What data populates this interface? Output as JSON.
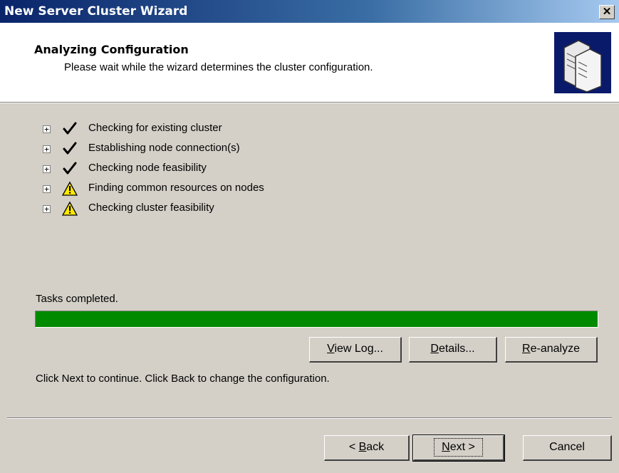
{
  "window": {
    "title": "New Server Cluster Wizard",
    "close_glyph": "✕"
  },
  "header": {
    "title": "Analyzing Configuration",
    "subtitle": "Please wait while the wizard determines the cluster configuration.",
    "icon": "server-cluster-icon"
  },
  "tasks": [
    {
      "label": "Checking for existing cluster",
      "status": "success",
      "expander": "+"
    },
    {
      "label": "Establishing node connection(s)",
      "status": "success",
      "expander": "+"
    },
    {
      "label": "Checking node feasibility",
      "status": "success",
      "expander": "+"
    },
    {
      "label": "Finding common resources on nodes",
      "status": "warning",
      "expander": "+"
    },
    {
      "label": "Checking cluster feasibility",
      "status": "warning",
      "expander": "+"
    }
  ],
  "progress": {
    "status_text": "Tasks completed.",
    "percent": 100,
    "color": "#008a00"
  },
  "actions": {
    "view_log": {
      "hotkey": "V",
      "rest": "iew Log..."
    },
    "details": {
      "hotkey": "D",
      "rest": "etails..."
    },
    "reanalyze": {
      "hotkey": "R",
      "rest": "e-analyze"
    }
  },
  "hint": "Click Next to continue. Click Back to change the configuration.",
  "nav": {
    "back": {
      "prefix": "< ",
      "hotkey": "B",
      "rest": "ack"
    },
    "next": {
      "hotkey": "N",
      "rest": "ext >"
    },
    "cancel": "Cancel"
  }
}
